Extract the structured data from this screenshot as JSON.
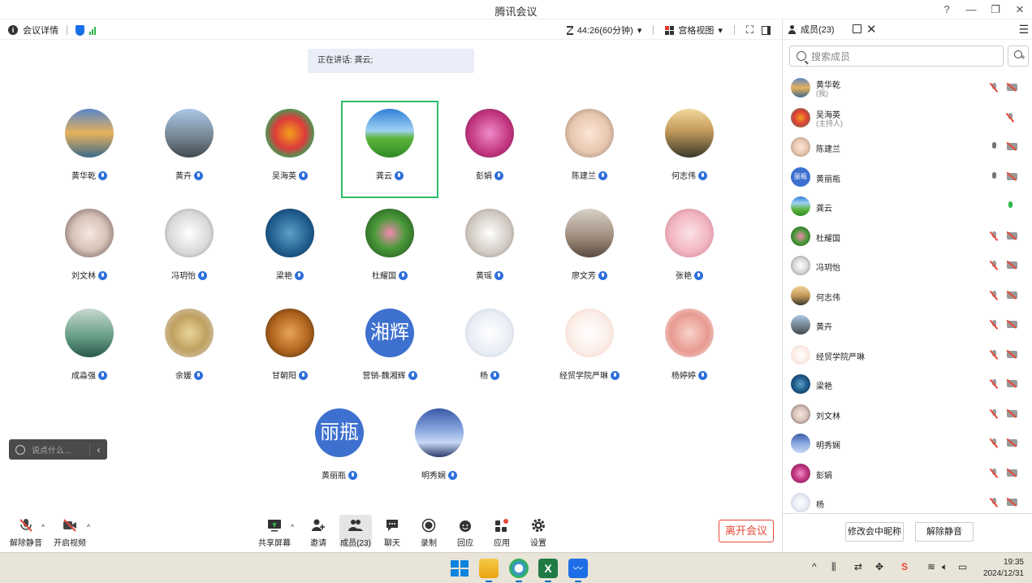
{
  "window": {
    "title": "腾讯会议",
    "controls": [
      "?",
      "—",
      "❐",
      "✕"
    ]
  },
  "topbar": {
    "meeting_details": "会议详情",
    "timer": "44:26(60分钟)",
    "view_mode": "宫格视图"
  },
  "speaking": "正在讲话: 龚云;",
  "participants": [
    {
      "name": "黄华乾",
      "bg": "linear-gradient(180deg,#5a86c9 0%,#e6b25c 50%,#3c6a8c 100%)"
    },
    {
      "name": "黄卉",
      "bg": "linear-gradient(180deg,#a9c6e6 0%,#7a8a96 55%,#404a50 100%)"
    },
    {
      "name": "吴海英",
      "bg": "radial-gradient(circle,#f2a01a 0%,#dd3b3b 45%,#3aa35a 75%,#eee 100%)"
    },
    {
      "name": "龚云",
      "bg": "linear-gradient(180deg,#2f7fd8 0%,#9fd1f2 45%,#5cb53c 60%,#2e8a25 100%)"
    },
    {
      "name": "彭娟",
      "bg": "radial-gradient(circle,#f08ac8 0%,#c0347e 60%,#6b1f4a 100%)"
    },
    {
      "name": "陈建兰",
      "bg": "radial-gradient(circle,#fbe6d6 0%,#e9c7b0 55%,#8a7a6a 100%)"
    },
    {
      "name": "何志伟",
      "bg": "linear-gradient(180deg,#f1d79c 0%,#c49a5a 45%,#3a3a2a 100%)"
    },
    {
      "name": "刘文林",
      "bg": "radial-gradient(circle,#f3e8e2 0%,#d8c2b8 50%,#5a4a4a 100%)"
    },
    {
      "name": "冯玥怡",
      "bg": "radial-gradient(circle,#ffffff 0%,#d8d8d8 60%,#777 100%)"
    },
    {
      "name": "梁艳",
      "bg": "radial-gradient(circle,#5aa0c8 0%,#1f5a8a 60%,#0e2a4a 100%)"
    },
    {
      "name": "杜耀国",
      "bg": "radial-gradient(circle,#f28ab0 0%,#4a9a3a 45%,#1e4a1a 100%)"
    },
    {
      "name": "黄瑶",
      "bg": "radial-gradient(circle,#ffffff 0%,#cfc8c0 60%,#8a8078 100%)"
    },
    {
      "name": "廖文芳",
      "bg": "linear-gradient(180deg,#d8d2c8 0%,#9c8a7a 60%,#5a4a40 100%)"
    },
    {
      "name": "张艳",
      "bg": "radial-gradient(circle,#fbe2e6 0%,#f2b6c2 55%,#c27a8a 100%)"
    },
    {
      "name": "成淼强",
      "bg": "linear-gradient(180deg,#c8d8d0 0%,#6aa08a 55%,#2a5a4a 100%)"
    },
    {
      "name": "余媛",
      "bg": "radial-gradient(circle,#e8d69a 0%,#c0a060 50%,#d8d4cc 100%)"
    },
    {
      "name": "甘朝阳",
      "bg": "radial-gradient(circle,#e8a45a 0%,#b0641e 55%,#3a2410 100%)"
    },
    {
      "name": "营销-魏湘辉",
      "text": "湘辉"
    },
    {
      "name": "杨",
      "bg": "radial-gradient(circle,#ffffff 0%,#e8ecf4 60%,#b8c4d8 100%)"
    },
    {
      "name": "经贸学院严琳",
      "bg": "radial-gradient(circle,#ffffff 0%,#fbeee8 55%,#f2d2c4 100%)"
    },
    {
      "name": "杨婷婷",
      "bg": "radial-gradient(circle,#f8d2cc 0%,#e89a90 55%,#f4eeee 100%)"
    },
    {
      "name": "黄丽瓶",
      "text": "丽瓶"
    },
    {
      "name": "明秀娴",
      "bg": "linear-gradient(180deg,#3a5aa8 0%,#8aa8e0 45%,#c8d8f4 70%,#2a3a6a 100%)"
    }
  ],
  "chat": {
    "placeholder": "说点什么..."
  },
  "toolbar": {
    "unmute": "解除静音",
    "start_video": "开启视频",
    "share_screen": "共享屏幕",
    "invite": "邀请",
    "members": "成员(23)",
    "chat": "聊天",
    "record": "录制",
    "reactions": "回应",
    "apps": "应用",
    "settings": "设置",
    "leave": "离开会议"
  },
  "panel": {
    "title": "成员(23)",
    "search_placeholder": "搜索成员",
    "members": [
      {
        "name": "黄华乾",
        "role": "(我)",
        "mic": "off",
        "cam": true,
        "bg": "linear-gradient(180deg,#5a86c9,#e6b25c,#3c6a8c)"
      },
      {
        "name": "吴海英",
        "role": "(主持人)",
        "mic": "off",
        "cam": false,
        "bg": "radial-gradient(circle,#f2a01a,#dd3b3b,#3aa35a)"
      },
      {
        "name": "陈建兰",
        "role": "",
        "mic": "gray",
        "cam": true,
        "bg": "radial-gradient(circle,#fbe6d6,#e9c7b0,#8a7a6a)"
      },
      {
        "name": "黄丽瓶",
        "role": "",
        "mic": "gray",
        "cam": true,
        "text": "丽瓶"
      },
      {
        "name": "龚云",
        "role": "",
        "mic": "on",
        "cam": false,
        "bg": "linear-gradient(180deg,#2f7fd8,#9fd1f2,#5cb53c,#2e8a25)"
      },
      {
        "name": "杜耀国",
        "role": "",
        "mic": "off",
        "cam": true,
        "bg": "radial-gradient(circle,#f28ab0,#4a9a3a,#1e4a1a)"
      },
      {
        "name": "冯玥怡",
        "role": "",
        "mic": "off",
        "cam": true,
        "bg": "radial-gradient(circle,#fff,#d8d8d8,#777)"
      },
      {
        "name": "何志伟",
        "role": "",
        "mic": "off",
        "cam": true,
        "bg": "linear-gradient(180deg,#f1d79c,#c49a5a,#3a3a2a)"
      },
      {
        "name": "黄卉",
        "role": "",
        "mic": "off",
        "cam": true,
        "bg": "linear-gradient(180deg,#a9c6e6,#7a8a96,#404a50)"
      },
      {
        "name": "经贸学院严琳",
        "role": "",
        "mic": "off",
        "cam": true,
        "bg": "radial-gradient(circle,#fff,#fbeee8,#f2d2c4)"
      },
      {
        "name": "梁艳",
        "role": "",
        "mic": "off",
        "cam": true,
        "bg": "radial-gradient(circle,#5aa0c8,#1f5a8a,#0e2a4a)"
      },
      {
        "name": "刘文林",
        "role": "",
        "mic": "off",
        "cam": true,
        "bg": "radial-gradient(circle,#f3e8e2,#d8c2b8,#5a4a4a)"
      },
      {
        "name": "明秀娴",
        "role": "",
        "mic": "off",
        "cam": true,
        "bg": "linear-gradient(180deg,#3a5aa8,#8aa8e0,#c8d8f4)"
      },
      {
        "name": "彭娟",
        "role": "",
        "mic": "off",
        "cam": true,
        "bg": "radial-gradient(circle,#f08ac8,#c0347e,#6b1f4a)"
      },
      {
        "name": "杨",
        "role": "",
        "mic": "off",
        "cam": true,
        "bg": "radial-gradient(circle,#fff,#e8ecf4,#b8c4d8)"
      }
    ],
    "rename_button": "修改会中昵称",
    "unmute_all_button": "解除静音"
  },
  "taskbar": {
    "time": "19:35",
    "date": "2024/12/31"
  }
}
